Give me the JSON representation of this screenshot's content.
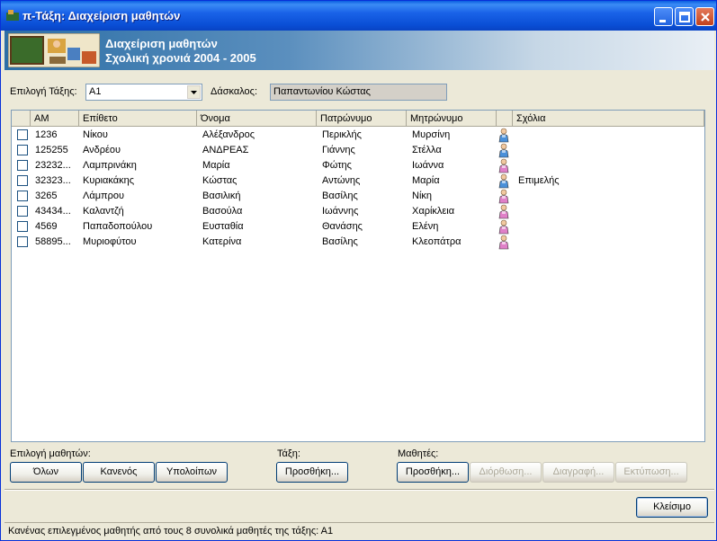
{
  "window": {
    "title": "π-Τάξη: Διαχείριση μαθητών"
  },
  "banner": {
    "line1": "Διαχείριση μαθητών",
    "line2": "Σχολική χρονιά  2004 -  2005"
  },
  "filter": {
    "class_label": "Επιλογή Τάξης:",
    "class_value": "Α1",
    "teacher_label": "Δάσκαλος:",
    "teacher_value": "Παπαντωνίου Κώστας"
  },
  "table": {
    "columns": [
      "ΑΜ",
      "Επίθετο",
      "Όνομα",
      "Πατρώνυμο",
      "Μητρώνυμο",
      "",
      "Σχόλια"
    ],
    "rows": [
      {
        "am": "1236",
        "surname": "Νίκου",
        "name": "Αλέξανδρος",
        "father": "Περικλής",
        "mother": "Μυρσίνη",
        "gender": "male",
        "comment": ""
      },
      {
        "am": "125255",
        "surname": "Ανδρέου",
        "name": "ΑΝΔΡΕΑΣ",
        "father": "Γιάννης",
        "mother": "Στέλλα",
        "gender": "male",
        "comment": ""
      },
      {
        "am": "23232...",
        "surname": "Λαμπρινάκη",
        "name": "Μαρία",
        "father": "Φώτης",
        "mother": "Ιωάννα",
        "gender": "female",
        "comment": ""
      },
      {
        "am": "32323...",
        "surname": "Κυριακάκης",
        "name": "Κώστας",
        "father": "Αντώνης",
        "mother": "Μαρία",
        "gender": "male",
        "comment": "Επιμελής"
      },
      {
        "am": "3265",
        "surname": "Λάμπρου",
        "name": "Βασιλική",
        "father": "Βασίλης",
        "mother": "Νίκη",
        "gender": "female",
        "comment": ""
      },
      {
        "am": "43434...",
        "surname": "Καλαντζή",
        "name": "Βασούλα",
        "father": "Ιωάννης",
        "mother": "Χαρίκλεια",
        "gender": "female",
        "comment": ""
      },
      {
        "am": "4569",
        "surname": "Παπαδοπούλου",
        "name": "Ευσταθία",
        "father": "Θανάσης",
        "mother": "Ελένη",
        "gender": "female",
        "comment": ""
      },
      {
        "am": "58895...",
        "surname": "Μυριοφύτου",
        "name": "Κατερίνα",
        "father": "Βασίλης",
        "mother": "Κλεοπάτρα",
        "gender": "female",
        "comment": ""
      }
    ]
  },
  "selection": {
    "label": "Επιλογή μαθητών:",
    "all": "Όλων",
    "none": "Κανενός",
    "rest": "Υπολοίπων"
  },
  "class_section": {
    "label": "Τάξη:",
    "add": "Προσθήκη..."
  },
  "students_section": {
    "label": "Μαθητές:",
    "add": "Προσθήκη...",
    "edit": "Διόρθωση...",
    "delete": "Διαγραφή...",
    "print": "Εκτύπωση..."
  },
  "close_button": "Κλείσιμο",
  "status": "Κανένας επιλεγμένος μαθητής από τους  8 συνολικά μαθητές της τάξης: Α1",
  "colors": {
    "titlebar": "#0a4fd6",
    "male_icon": "#4a90d9",
    "female_icon": "#e080c8"
  }
}
